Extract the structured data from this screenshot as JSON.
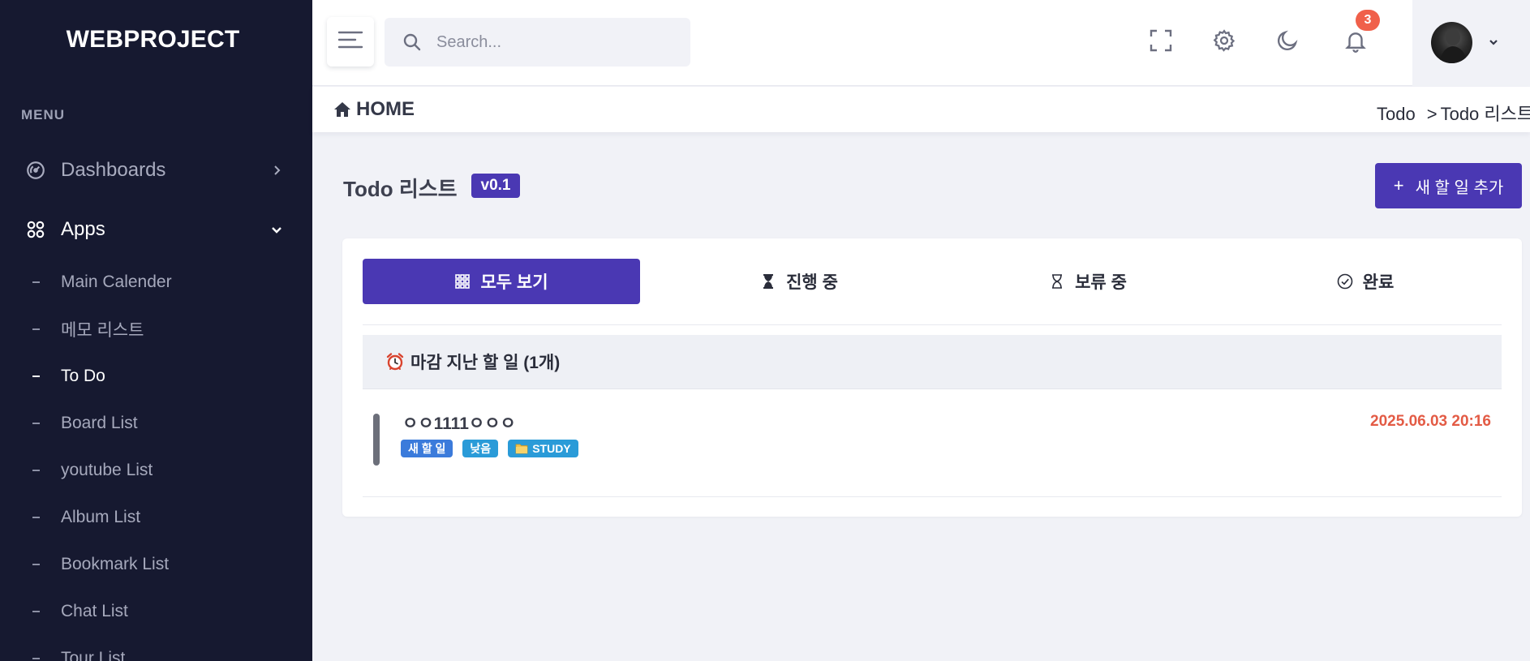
{
  "app": {
    "brand": "WEBPROJECT"
  },
  "sidebar": {
    "menu_heading": "MENU",
    "sections": [
      {
        "label": "Dashboards",
        "icon": "dashboard-gauge-icon",
        "expanded": false
      },
      {
        "label": "Apps",
        "icon": "apps-grid-icon",
        "expanded": true
      }
    ],
    "sub_items": [
      {
        "label": "Main Calender",
        "active": false
      },
      {
        "label": "메모 리스트",
        "active": false
      },
      {
        "label": "To Do",
        "active": true
      },
      {
        "label": "Board List",
        "active": false
      },
      {
        "label": "youtube List",
        "active": false
      },
      {
        "label": "Album List",
        "active": false
      },
      {
        "label": "Bookmark List",
        "active": false
      },
      {
        "label": "Chat List",
        "active": false
      },
      {
        "label": "Tour List",
        "active": false
      }
    ]
  },
  "header": {
    "search_placeholder": "Search...",
    "notification_count": "3",
    "icons": [
      "fullscreen-icon",
      "settings-gear-icon",
      "dark-mode-moon-icon",
      "notification-bell-icon"
    ]
  },
  "breadcrumb": {
    "home_label": "HOME",
    "items": [
      "Todo",
      "Todo 리스트"
    ],
    "separator": ">"
  },
  "page": {
    "title": "Todo 리스트",
    "version": "v0.1",
    "add_button_label": "새 할 일 추가"
  },
  "filters": [
    {
      "label": "모두 보기",
      "icon": "grid-icon",
      "active": true
    },
    {
      "label": "진행 중",
      "icon": "hourglass-filled-icon",
      "active": false
    },
    {
      "label": "보류 중",
      "icon": "hourglass-outline-icon",
      "active": false
    },
    {
      "label": "완료",
      "icon": "check-circle-icon",
      "active": false
    }
  ],
  "overdue_section": {
    "title": "마감 지난 할 일 (1개)",
    "icon": "alarm-clock-icon"
  },
  "todos": [
    {
      "title": "ㅇㅇ1111ㅇㅇㅇ",
      "due": "2025.06.03 20:16",
      "tags": [
        {
          "label": "새 할 일",
          "color": "#3b7bdb"
        },
        {
          "label": "낮음",
          "color": "#2a9bd8"
        },
        {
          "label": "STUDY",
          "color": "#2a9bd8",
          "icon": "folder-icon"
        }
      ]
    }
  ],
  "colors": {
    "sidebar_bg": "#161930",
    "accent": "#4a38b3",
    "badge": "#f0604a",
    "overdue_date": "#e35b45",
    "page_bg": "#f1f2f7"
  }
}
